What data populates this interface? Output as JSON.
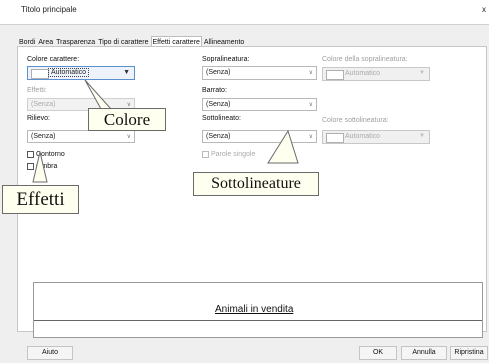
{
  "window": {
    "title": "Titolo principale",
    "close_glyph": "x"
  },
  "tabs": [
    {
      "label": "Bordi"
    },
    {
      "label": "Area"
    },
    {
      "label": "Trasparenza"
    },
    {
      "label": "Tipo di carattere"
    },
    {
      "label": "Effetti carattere",
      "active": true
    },
    {
      "label": "Allineamento"
    }
  ],
  "font_color": {
    "label": "Colore carattere:",
    "value": "Automatico"
  },
  "effects": {
    "label": "Effetti:",
    "value": "(Senza)"
  },
  "relief": {
    "label": "Rilievo:",
    "value": "(Senza)"
  },
  "outline": {
    "label": "Contorno",
    "checked": false
  },
  "shadow": {
    "label": "Ombra",
    "checked": false
  },
  "overline": {
    "label": "Sopralineatura:",
    "value": "(Senza)",
    "color_label": "Colore della sopralineatura:",
    "color_value": "Automatico"
  },
  "strikethrough": {
    "label": "Barrato:",
    "value": "(Senza)"
  },
  "underline": {
    "label": "Sottolineato:",
    "value": "(Senza)",
    "color_label": "Colore sottolineatura:",
    "color_value": "Automatico"
  },
  "individual_words": {
    "label": "Parole singole",
    "checked": false
  },
  "preview": {
    "text": "Animali in vendita"
  },
  "buttons": {
    "help": "Aiuto",
    "ok": "OK",
    "cancel": "Annulla",
    "reset": "Ripristina"
  },
  "callouts": {
    "colore": "Colore",
    "sottolineature": "Sottolineature",
    "effetti": "Effetti"
  },
  "colors": {
    "callout_fill": "#fffff0",
    "focus_border": "#5b8fd0",
    "panel_bg": "#efefef"
  }
}
